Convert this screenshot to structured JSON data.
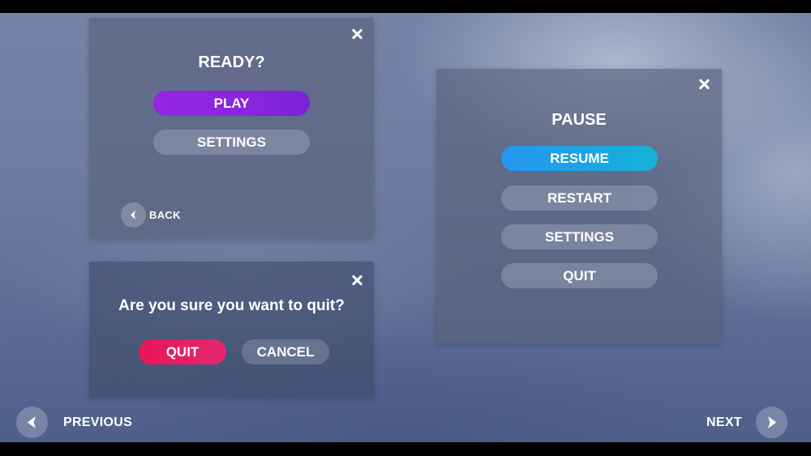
{
  "ready_panel": {
    "title": "READY?",
    "play_label": "PLAY",
    "settings_label": "SETTINGS",
    "back_label": "BACK",
    "close_icon": "close-icon",
    "back_icon": "chevron-left-icon"
  },
  "quit_panel": {
    "message": "Are you sure you want to quit?",
    "quit_label": "QUIT",
    "cancel_label": "CANCEL",
    "close_icon": "close-icon"
  },
  "pause_panel": {
    "title": "PAUSE",
    "buttons": [
      {
        "label": "RESUME"
      },
      {
        "label": "RESTART"
      },
      {
        "label": "SETTINGS"
      },
      {
        "label": "QUIT"
      }
    ],
    "close_icon": "close-icon"
  },
  "navigation": {
    "previous_label": "PREVIOUS",
    "next_label": "NEXT",
    "previous_icon": "chevron-left-icon",
    "next_icon": "chevron-right-icon"
  },
  "colors": {
    "play": "#8a25dd",
    "resume": "#1aa6e0",
    "quit": "#e8155a"
  }
}
